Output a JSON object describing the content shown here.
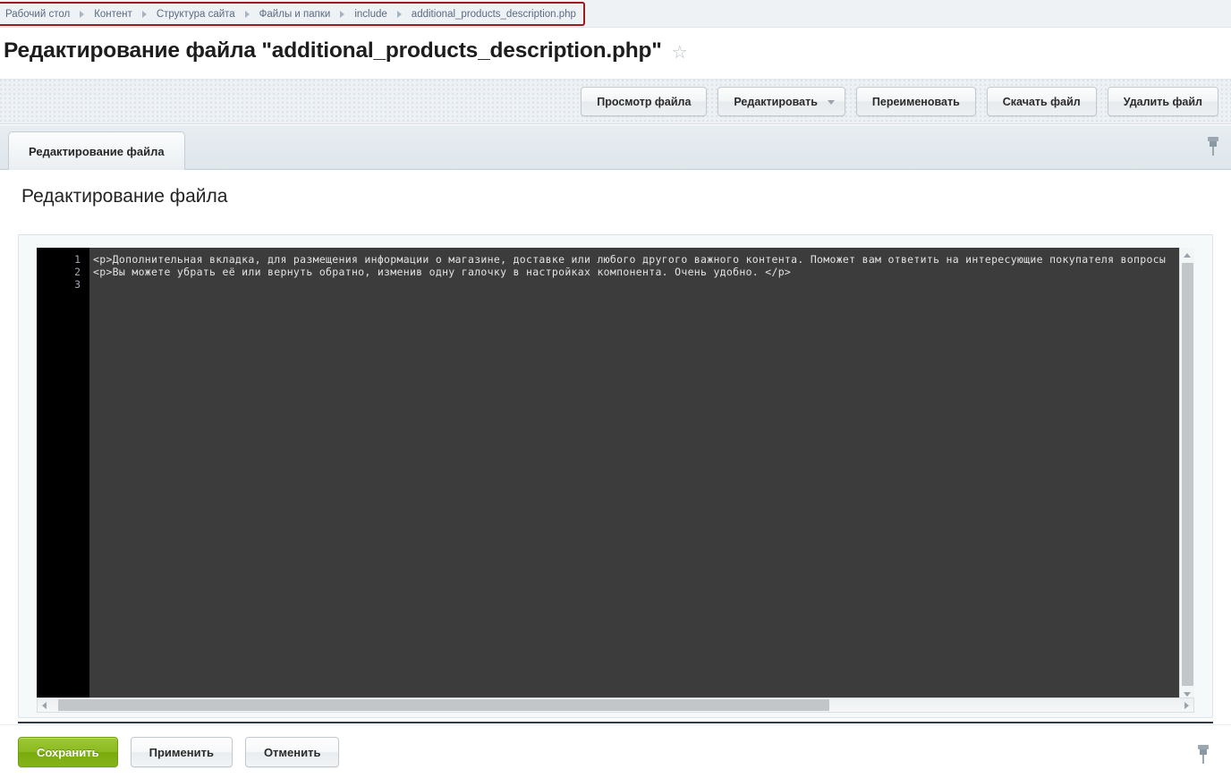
{
  "breadcrumb": {
    "items": [
      {
        "label": "Рабочий стол"
      },
      {
        "label": "Контент"
      },
      {
        "label": "Структура сайта"
      },
      {
        "label": "Файлы и папки"
      },
      {
        "label": "include"
      },
      {
        "label": "additional_products_description.php"
      }
    ],
    "highlight_color": "#9b1c1c"
  },
  "header": {
    "title": "Редактирование файла \"additional_products_description.php\"",
    "favorite_icon": "star-icon",
    "favorite_glyph": "☆"
  },
  "toolbar": {
    "buttons": [
      {
        "label": "Просмотр файла",
        "name": "view-file-button",
        "split": false
      },
      {
        "label": "Редактировать",
        "name": "edit-button",
        "split": true
      },
      {
        "label": "Переименовать",
        "name": "rename-button",
        "split": false
      },
      {
        "label": "Скачать файл",
        "name": "download-file-button",
        "split": false
      },
      {
        "label": "Удалить файл",
        "name": "delete-file-button",
        "split": false
      }
    ]
  },
  "tabs": [
    {
      "label": "Редактирование файла",
      "active": true
    }
  ],
  "tabstrip": {
    "pin_icon": "pin-icon"
  },
  "section": {
    "heading": "Редактирование файла"
  },
  "editor": {
    "line_numbers": [
      "1",
      "2",
      "3"
    ],
    "lines": [
      "<p>Дополнительная вкладка, для размещения информации о магазине, доставке или любого другого важного контента. Поможет вам ответить на интересующие покупателя вопросы",
      "<p>Вы можете убрать её или вернуть обратно, изменив одну галочку в настройках компонента. Очень удобно. </p>",
      ""
    ],
    "background_color": "#3c3c3c",
    "gutter_color": "#000000",
    "text_color": "#e3e3e3",
    "vertical_scrollbar": {
      "up_arrow": "triangle-up-icon",
      "down_arrow": "triangle-down-icon"
    },
    "horizontal_scrollbar": {
      "left_arrow": "triangle-left-icon",
      "right_arrow": "triangle-right-icon"
    }
  },
  "footer": {
    "save_label": "Сохранить",
    "apply_label": "Применить",
    "cancel_label": "Отменить",
    "save_color": "#8cbb22",
    "pin_icon": "pin-icon"
  }
}
